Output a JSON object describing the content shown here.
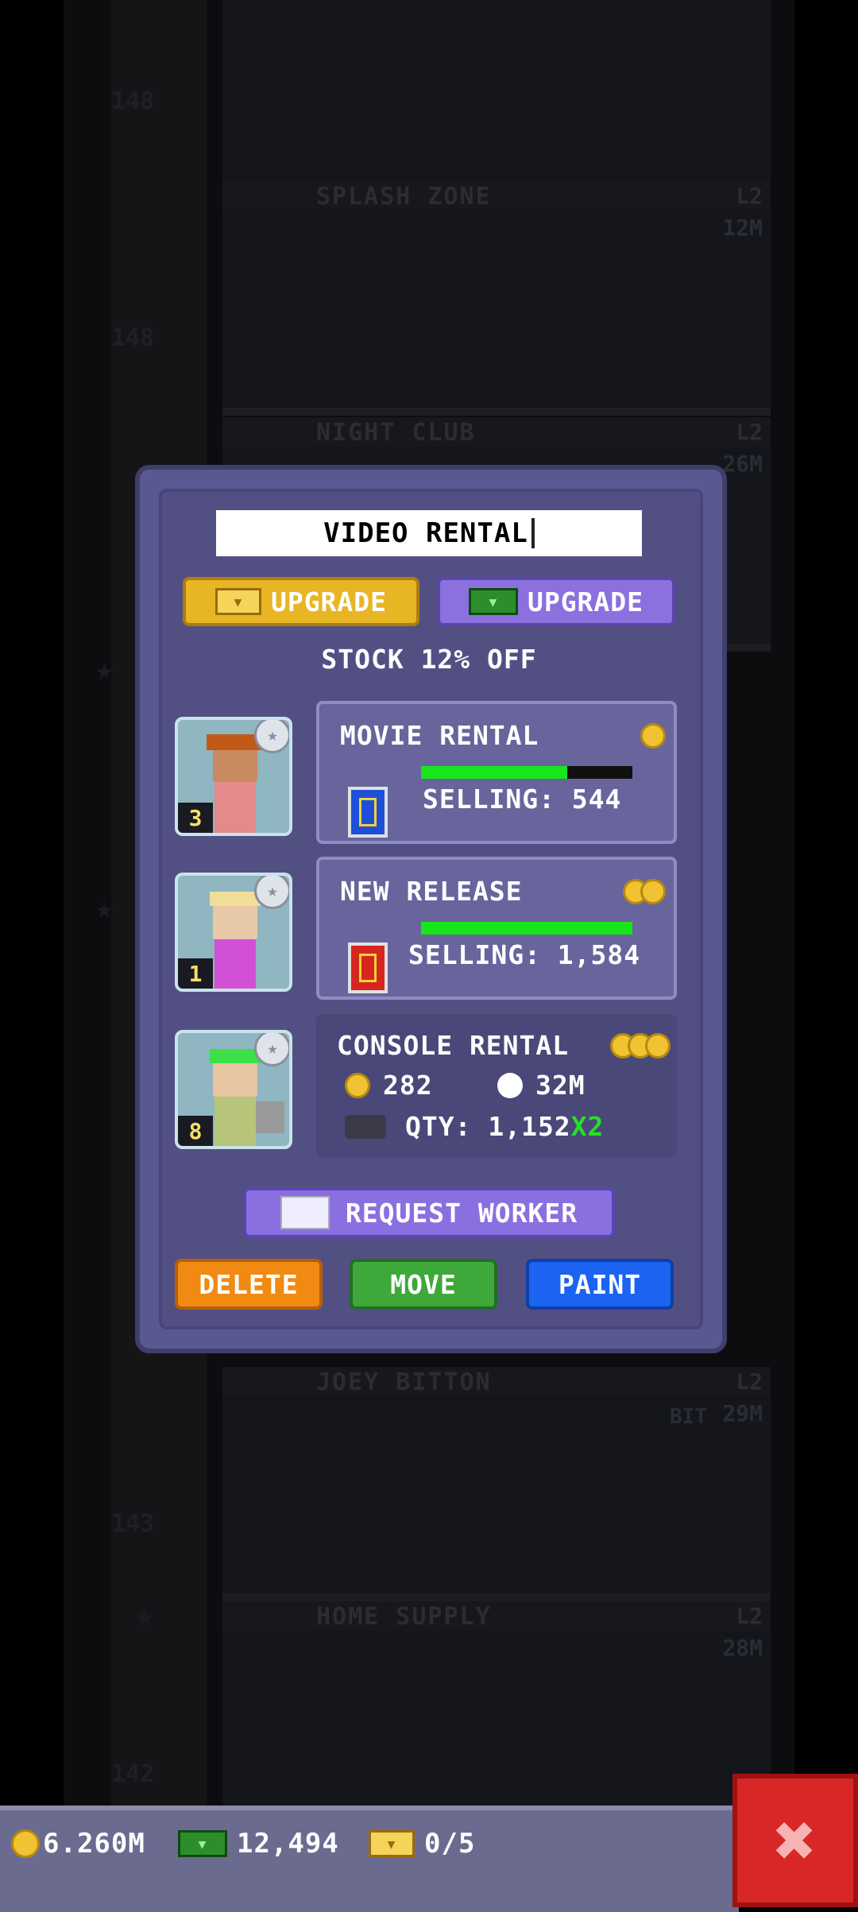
{
  "background": {
    "floors": [
      {
        "name": "",
        "lvl": "",
        "price": "",
        "num": "148"
      },
      {
        "name": "SPLASH ZONE",
        "lvl": "L2",
        "price": "12M",
        "num": "148"
      },
      {
        "name": "NIGHT CLUB",
        "lvl": "L2",
        "price": "26M",
        "num": ""
      },
      {
        "name": "JOEY BITTON",
        "lvl": "L2",
        "price": "29M",
        "num": "143"
      },
      {
        "name": "HOME SUPPLY",
        "lvl": "L2",
        "price": "28M",
        "num": "142"
      }
    ],
    "bit_label": "BIT"
  },
  "dialog": {
    "store_name": "VIDEO RENTAL",
    "upgrade_gold_label": "UPGRADE",
    "upgrade_cash_label": "UPGRADE",
    "stock_text": "STOCK 12% OFF",
    "workers": [
      {
        "level": "3"
      },
      {
        "level": "1"
      },
      {
        "level": "8"
      }
    ],
    "products": [
      {
        "name": "MOVIE RENTAL",
        "selling": "SELLING: 544",
        "progress": 0.69,
        "coins": 1
      },
      {
        "name": "NEW RELEASE",
        "selling": "SELLING: 1,584",
        "progress": 1.0,
        "coins": 2
      },
      {
        "name": "CONSOLE RENTAL",
        "cost": "282",
        "time": "32M",
        "qty": "QTY: 1,152",
        "multiplier": "X2",
        "coins": 3
      }
    ],
    "request_worker_label": "REQUEST WORKER",
    "delete_label": "DELETE",
    "move_label": "MOVE",
    "paint_label": "PAINT"
  },
  "status": {
    "coins": "6.260M",
    "bux": "12,494",
    "tickets": "0/5"
  },
  "colors": {
    "gold": "#e8b524",
    "purple": "#8c70de",
    "delete": "#f08a12",
    "move": "#3ea83a",
    "paint": "#1b63f0",
    "close": "#d92626"
  }
}
